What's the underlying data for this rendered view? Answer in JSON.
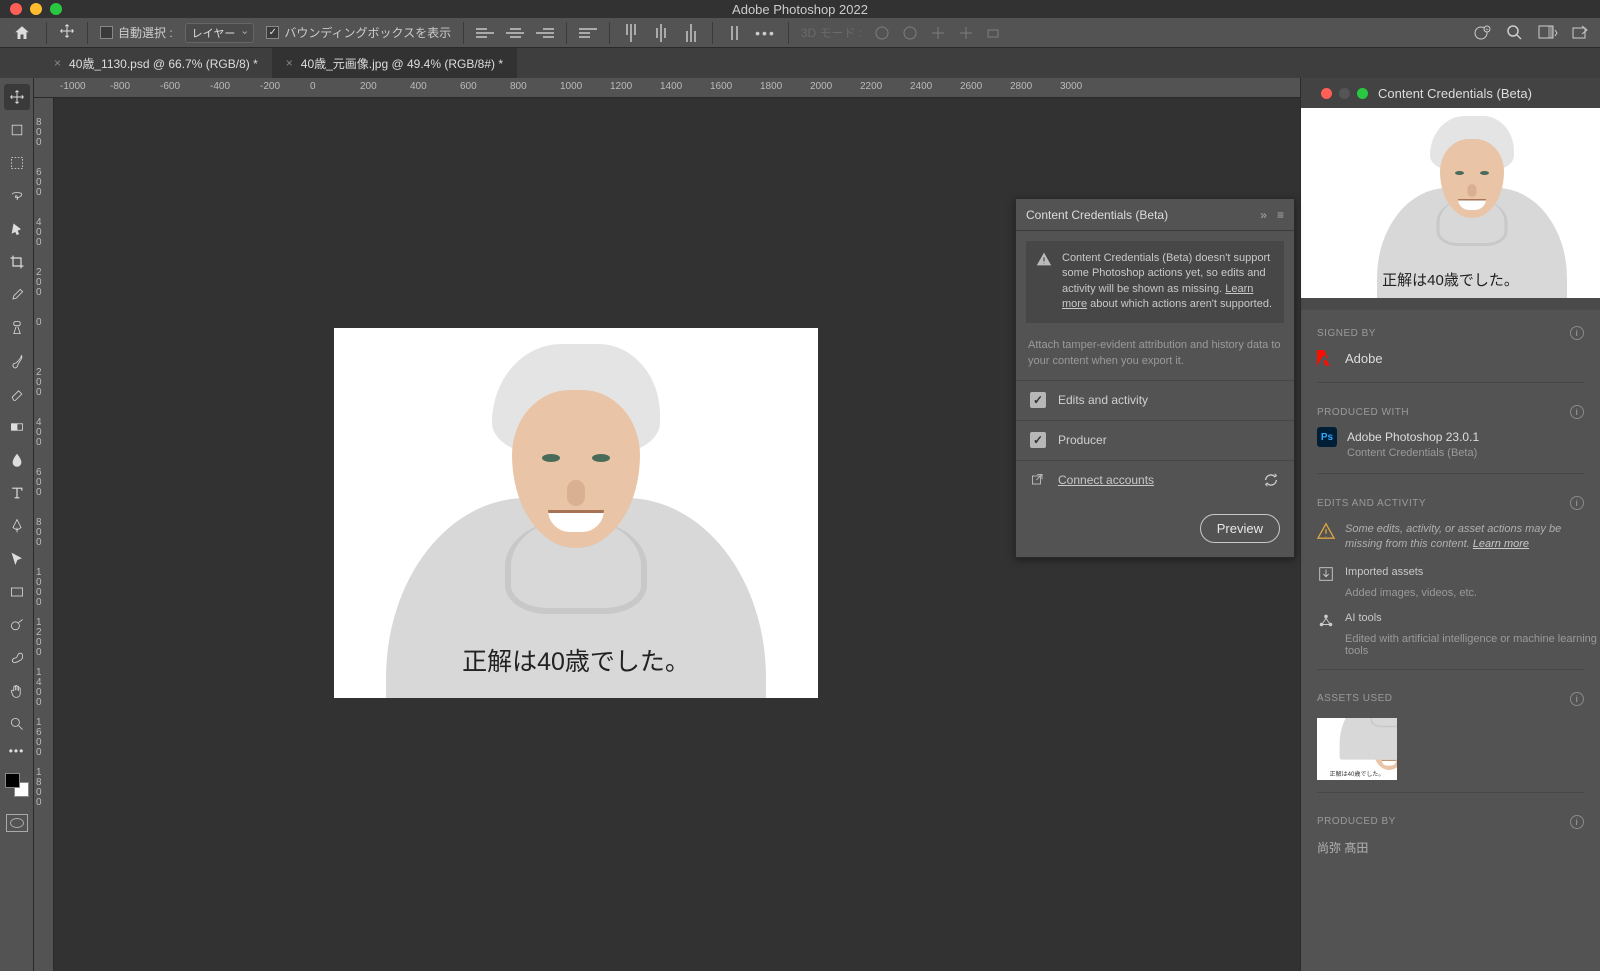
{
  "app_title": "Adobe Photoshop 2022",
  "option_bar": {
    "auto_select_label": "自動選択 :",
    "layer_select": "レイヤー",
    "bbox_label": "バウンディングボックスを表示",
    "mode3d_label": "3D モード :"
  },
  "tabs": [
    {
      "name": "40歳_1130.psd @ 66.7% (RGB/8) *",
      "active": false
    },
    {
      "name": "40歳_元画像.jpg @ 49.4% (RGB/8#) *",
      "active": true
    }
  ],
  "ruler": {
    "h": [
      "-1000",
      "-800",
      "-600",
      "-400",
      "-200",
      "0",
      "200",
      "400",
      "600",
      "800",
      "1000",
      "1200",
      "1400",
      "1600",
      "1800",
      "2000",
      "2200",
      "2400",
      "2600",
      "2800",
      "3000"
    ],
    "v": [
      "800",
      "600",
      "400",
      "200",
      "0",
      "200",
      "400",
      "600",
      "800",
      "1000",
      "1200",
      "1400",
      "1600",
      "1800"
    ]
  },
  "canvas_caption": "正解は40歳でした。",
  "mid_panel": {
    "title": "Content Credentials (Beta)",
    "warn": "Content Credentials (Beta) doesn't support some Photoshop actions yet, so edits and activity will be shown as missing.",
    "warn_link": "Learn more",
    "warn_tail": " about which actions aren't supported.",
    "desc": "Attach tamper-evident attribution and history data to your content when you export it.",
    "edits_label": "Edits and activity",
    "producer_label": "Producer",
    "connect_label": "Connect accounts",
    "preview_label": "Preview"
  },
  "right": {
    "title": "Content Credentials (Beta)",
    "caption": "正解は40歳でした。",
    "signed_by_h": "SIGNED BY",
    "signed_by": "Adobe",
    "produced_with_h": "PRODUCED WITH",
    "produced_with": "Adobe Photoshop 23.0.1",
    "produced_with_sub": "Content Credentials (Beta)",
    "edits_h": "EDITS AND ACTIVITY",
    "edits_warn": "Some edits, activity, or asset actions may be missing from this content.",
    "edits_link": "Learn more",
    "imported": "Imported assets",
    "imported_sub": "Added images, videos, etc.",
    "ai": "AI tools",
    "ai_sub": "Edited with artificial intelligence or machine learning tools",
    "assets_h": "ASSETS USED",
    "asset_cap": "正解は40歳でした。",
    "produced_by_h": "PRODUCED BY",
    "produced_by": "尚弥 髙田"
  }
}
